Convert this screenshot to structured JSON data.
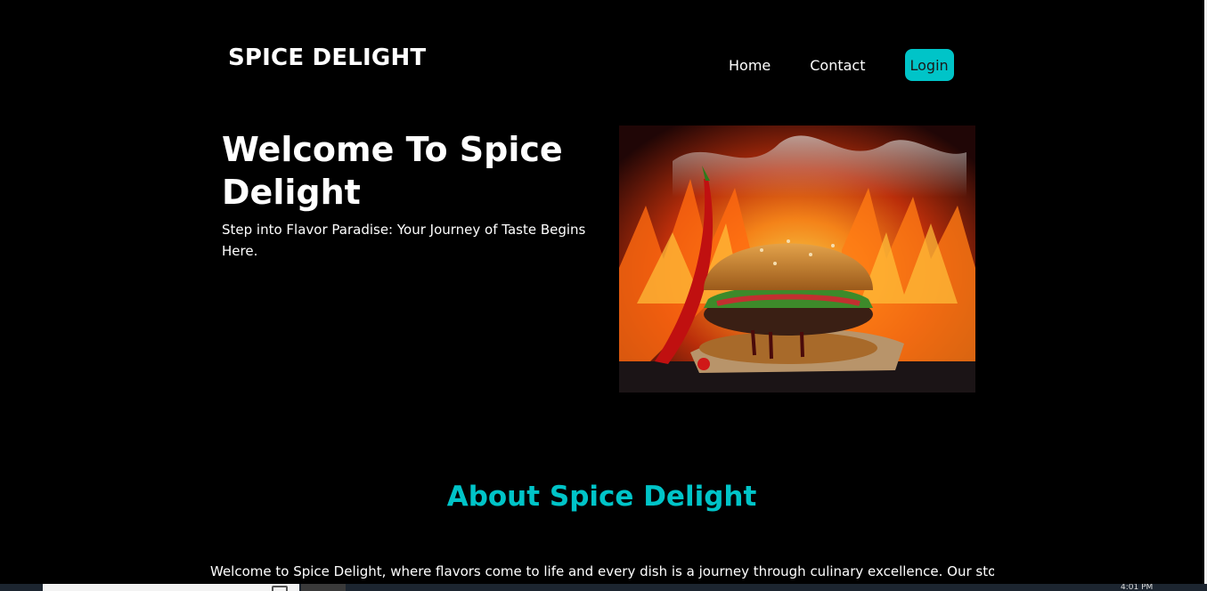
{
  "header": {
    "brand": "SPICE DELIGHT",
    "nav": {
      "home_label": "Home",
      "contact_label": "Contact",
      "login_label": "Login"
    }
  },
  "hero": {
    "title": "Welcome To Spice Delight",
    "subtitle": "Step into Flavor Paradise: Your Journey of Taste Begins Here.",
    "image_icon": "burger-flames-photo"
  },
  "about": {
    "title": "About Spice Delight",
    "text": "Welcome to Spice Delight, where flavors come to life and every dish is a journey through culinary excellence. Our story"
  },
  "taskbar": {
    "clock": "4:01 PM"
  },
  "colors": {
    "background": "#000000",
    "accent": "#00c4c8",
    "text": "#ffffff"
  }
}
